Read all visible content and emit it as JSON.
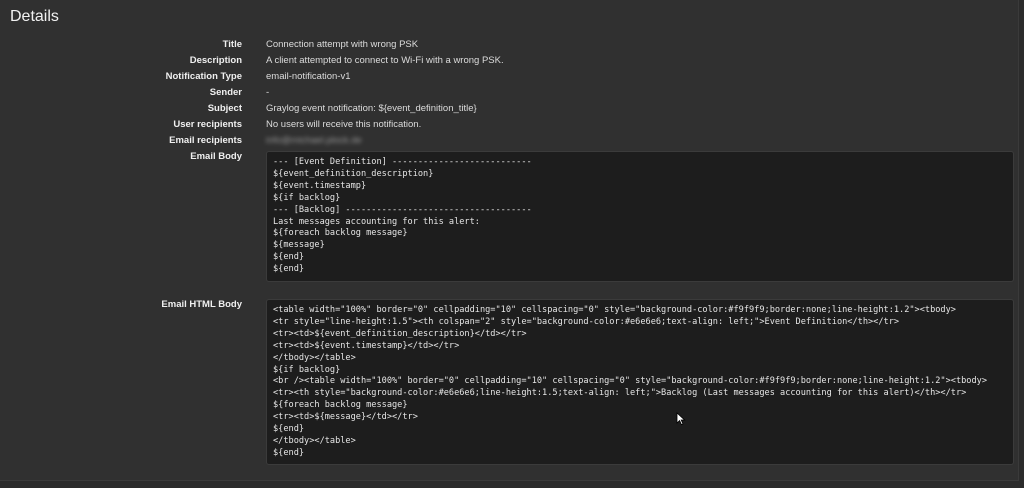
{
  "page": {
    "title": "Details"
  },
  "details": {
    "title": {
      "label": "Title",
      "value": "Connection attempt with wrong PSK"
    },
    "description": {
      "label": "Description",
      "value": "A client attempted to connect to Wi-Fi with a wrong PSK."
    },
    "notification_type": {
      "label": "Notification Type",
      "value": "email-notification-v1"
    },
    "sender": {
      "label": "Sender",
      "value": "-"
    },
    "subject": {
      "label": "Subject",
      "value": "Graylog event notification: ${event_definition_title}"
    },
    "user_recipients": {
      "label": "User recipients",
      "value": "No users will receive this notification."
    },
    "email_recipients": {
      "label": "Email recipients",
      "value": "info@michael.plock.de"
    },
    "email_body": {
      "label": "Email Body",
      "lines": [
        "--- [Event Definition] ---------------------------",
        "${event_definition_description}",
        "${event.timestamp}",
        "${if backlog}",
        "--- [Backlog] ------------------------------------",
        "Last messages accounting for this alert:",
        "${foreach backlog message}",
        "${message}",
        "${end}",
        "${end}"
      ]
    },
    "email_html_body": {
      "label": "Email HTML Body",
      "lines": [
        "<table width=\"100%\" border=\"0\" cellpadding=\"10\" cellspacing=\"0\" style=\"background-color:#f9f9f9;border:none;line-height:1.2\"><tbody>",
        "<tr style=\"line-height:1.5\"><th colspan=\"2\" style=\"background-color:#e6e6e6;text-align: left;\">Event Definition</th></tr>",
        "<tr><td>${event_definition_description}</td></tr>",
        "<tr><td>${event.timestamp}</td></tr>",
        "</tbody></table>",
        "${if backlog}",
        "<br /><table width=\"100%\" border=\"0\" cellpadding=\"10\" cellspacing=\"0\" style=\"background-color:#f9f9f9;border:none;line-height:1.2\"><tbody>",
        "<tr><th style=\"background-color:#e6e6e6;line-height:1.5;text-align: left;\">Backlog (Last messages accounting for this alert)</th></tr>",
        "${foreach backlog message}",
        "<tr><td>${message}</td></tr>",
        "${end}",
        "</tbody></table>",
        "${end}"
      ]
    }
  }
}
